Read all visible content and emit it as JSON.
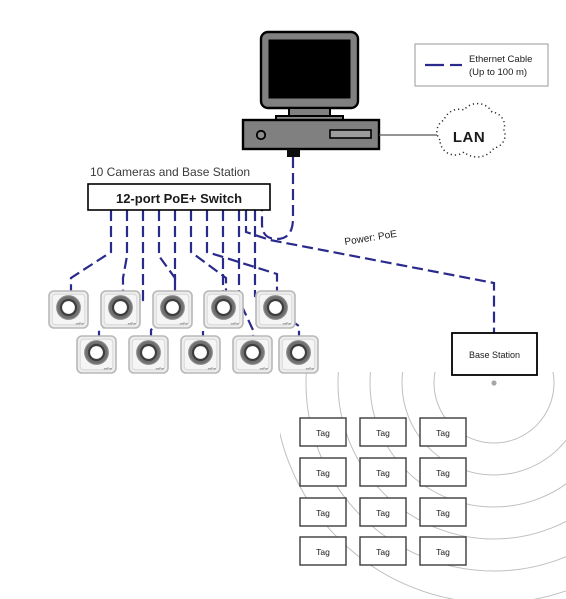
{
  "diagram": {
    "title_caption": "10 Cameras and Base Station",
    "switch": {
      "label": "12-port PoE+ Switch",
      "port_count": 12
    },
    "legend": {
      "line_label_1": "Ethernet Cable",
      "line_label_2": "(Up to 100 m)"
    },
    "lan": {
      "label": "LAN"
    },
    "power_label": "Power: PoE",
    "base_station": {
      "label": "Base Station"
    },
    "camera": {
      "brand_label": "netPoe",
      "count": 10,
      "row_top_count": 5,
      "row_bottom_count": 5
    },
    "tags": {
      "label": "Tag",
      "rows": 4,
      "columns": 3,
      "count": 12
    },
    "colors": {
      "cable": "#2a2a8c",
      "monitor_body": "#808080",
      "monitor_screen": "#000000",
      "tower_body": "#808080",
      "outline": "#000000",
      "wave": "#b0b0b0",
      "camera_body": "#ededed",
      "camera_ring": "#767676",
      "lan_line": "#555555"
    }
  }
}
